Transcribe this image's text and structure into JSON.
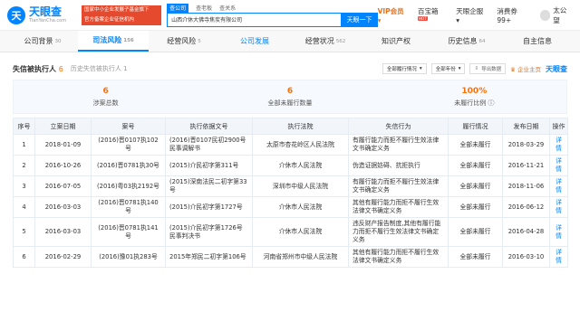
{
  "logo": {
    "name": "天眼查",
    "url": "TianYanCha.com",
    "mark": "天"
  },
  "banner": {
    "line1": "国家中小企业发展子基金旗下",
    "line2": "官方备案企业征信机构"
  },
  "search": {
    "tabs": [
      "查公司",
      "查老板",
      "查关系"
    ],
    "query": "山西介休大佛寺焦炭有限公司",
    "button": "天眼一下"
  },
  "nav": {
    "vip": "VIP会员",
    "items": [
      "百宝箱",
      "天眼企服",
      "消费券99+"
    ],
    "user": "太公望",
    "hot": "HOT"
  },
  "tabs": [
    {
      "label": "公司背景",
      "count": "30"
    },
    {
      "label": "司法风险",
      "count": "156"
    },
    {
      "label": "经营风险",
      "count": "5"
    },
    {
      "label": "公司发展",
      "count": ""
    },
    {
      "label": "经营状况",
      "count": "562"
    },
    {
      "label": "知识产权",
      "count": ""
    },
    {
      "label": "历史信息",
      "count": "64"
    },
    {
      "label": "自主信息",
      "count": ""
    }
  ],
  "panel": {
    "title": "失信被执行人",
    "title_count": "6",
    "sub": "历史失信被执行人",
    "sub_count": "1",
    "filter1": "全部履行情况",
    "filter2": "全部年份",
    "export": "导出数据",
    "pro": "企业主页",
    "watermark": "天眼查"
  },
  "stats": [
    {
      "value": "6",
      "label": "涉案总数"
    },
    {
      "value": "6",
      "label": "全部未履行数量"
    },
    {
      "value": "100%",
      "label": "未履行比例"
    }
  ],
  "table": {
    "headers": [
      "序号",
      "立案日期",
      "案号",
      "执行依据文号",
      "执行法院",
      "失信行为",
      "履行情况",
      "发布日期",
      "操作"
    ],
    "rows": [
      [
        "1",
        "2018-01-09",
        "(2016)晋0107执102号",
        "(2016)晋0107民初2900号民事调解书",
        "太原市杏花岭区人民法院",
        "有履行能力而拒不履行生效法律文书确定义务",
        "全部未履行",
        "2018-03-29",
        "详情"
      ],
      [
        "2",
        "2016-10-26",
        "(2016)晋0781执30号",
        "(2015)介民初字第311号",
        "介休市人民法院",
        "伪造证据妨碍、抗拒执行",
        "全部未履行",
        "2016-11-21",
        "详情"
      ],
      [
        "3",
        "2016-07-05",
        "(2016)粤03执2192号",
        "(2015)深南法民二初字第33号",
        "深圳市中级人民法院",
        "有履行能力而拒不履行生效法律文书确定义务",
        "全部未履行",
        "2018-11-06",
        "详情"
      ],
      [
        "4",
        "2016-03-03",
        "(2016)晋0781执140号",
        "(2015)介民初字第1727号",
        "介休市人民法院",
        "其他有履行能力而拒不履行生效法律文书确定义务",
        "全部未履行",
        "2016-06-12",
        "详情"
      ],
      [
        "5",
        "2016-03-03",
        "(2016)晋0781执141号",
        "(2015)介民初字第1726号民事判决书",
        "介休市人民法院",
        "违反财产报告制度,其他有履行能力而拒不履行生效法律文书确定义务",
        "全部未履行",
        "2016-04-28",
        "详情"
      ],
      [
        "6",
        "2016-02-29",
        "(2016)豫01执283号",
        "2015年郑民二初字第106号",
        "河南省郑州市中级人民法院",
        "其他有履行能力而拒不履行生效法律文书确定义务",
        "全部未履行",
        "2016-03-10",
        "详情"
      ]
    ]
  }
}
